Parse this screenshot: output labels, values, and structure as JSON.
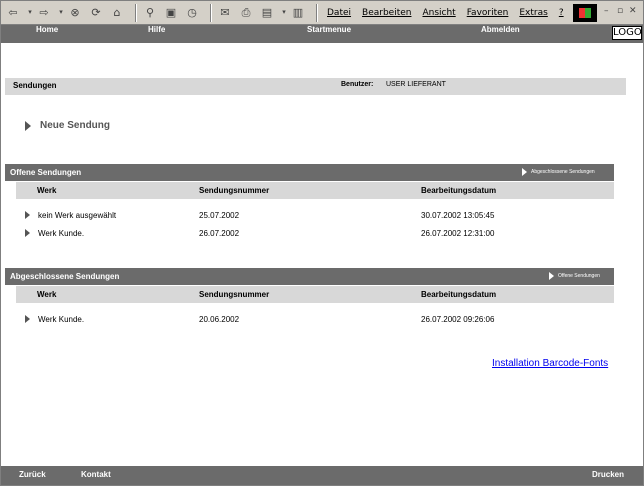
{
  "browser": {
    "toolbar_icons": [
      "back-icon",
      "dropdown-icon",
      "forward-icon",
      "dropdown-icon",
      "stop-icon",
      "refresh-icon",
      "home-icon",
      "search-icon",
      "favorites-icon",
      "history-icon",
      "mail-icon",
      "print-icon",
      "edit-icon",
      "dropdown-icon",
      "discuss-icon"
    ],
    "menu": [
      {
        "label": "Datei",
        "underline": "D"
      },
      {
        "label": "Bearbeiten",
        "underline": "B"
      },
      {
        "label": "Ansicht",
        "underline": "A"
      },
      {
        "label": "Favoriten",
        "underline": "F"
      },
      {
        "label": "Extras",
        "underline": "E"
      },
      {
        "label": "?",
        "underline": "?"
      }
    ]
  },
  "topnav": {
    "home": "Home",
    "hilfe": "Hilfe",
    "startmenue": "Startmenue",
    "abmelden": "Abmelden",
    "logo": "LOGO"
  },
  "header": {
    "title": "Sendungen",
    "user_label": "Benutzer:",
    "user_value": "USER LIEFERANT"
  },
  "neue_sendung": "Neue Sendung",
  "offene": {
    "title": "Offene Sendungen",
    "link": "Abgeschlossene Sendungen",
    "columns": [
      "Werk",
      "Sendungsnummer",
      "Bearbeitungsdatum"
    ],
    "rows": [
      {
        "werk": "kein Werk ausgewählt",
        "nummer": "25.07.2002",
        "datum": "30.07.2002 13:05:45"
      },
      {
        "werk": "Werk Kunde.",
        "nummer": "26.07.2002",
        "datum": "26.07.2002 12:31:00"
      }
    ]
  },
  "abgeschlossene": {
    "title": "Abgeschlossene Sendungen",
    "link": "Offene Sendungen",
    "columns": [
      "Werk",
      "Sendungsnummer",
      "Bearbeitungsdatum"
    ],
    "rows": [
      {
        "werk": "Werk Kunde.",
        "nummer": "20.06.2002",
        "datum": "26.07.2002 09:26:06"
      }
    ]
  },
  "barcode_link": "Installation Barcode-Fonts",
  "bottomnav": {
    "zurueck": "Zurück",
    "kontakt": "Kontakt",
    "drucken": "Drucken"
  },
  "colors": {
    "bar": "#6b6b6b",
    "light_bar": "#d8d8d8",
    "link": "#0000ee",
    "toolbar": "#d4d0c8"
  }
}
